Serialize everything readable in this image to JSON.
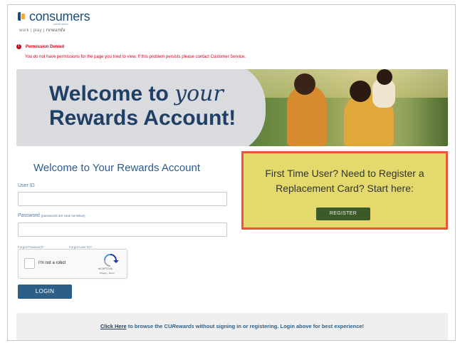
{
  "logo": {
    "wordmark": "consumers",
    "subtext": "credit union",
    "tagline_prefix": "work | play | ",
    "tagline_script": "rewards"
  },
  "error": {
    "icon": "alert-icon",
    "title": "Permission Denied",
    "message": "You do not have permissions for the page you tried to view. If this problem persists please contact Customer Service."
  },
  "banner": {
    "line1_prefix": "Welcome to ",
    "line1_script": "your",
    "line2": "Rewards Account!"
  },
  "login": {
    "heading": "Welcome to Your Rewards Account",
    "user_id_label": "User ID",
    "password_label": "Password",
    "password_note": "(passwords are case sensitive)",
    "forgot_password": "Forgot Password?",
    "forgot_user_id": "Forgot User ID?",
    "login_button": "LOGIN"
  },
  "captcha": {
    "checkbox_label": "I'm not a robot",
    "brand": "reCAPTCHA",
    "terms": "Privacy - Terms"
  },
  "register": {
    "text": "First Time User? Need to Register a Replacement Card? Start here:",
    "button": "REGISTER"
  },
  "footer": {
    "link_text": "Click Here",
    "text_before_italic": " to browse the CU",
    "italic_text": "Rewards",
    "text_after": " without signing in or registering. Login above for best experience!"
  },
  "colors": {
    "brand_blue": "#1f3f66",
    "error_red": "#d0021b",
    "register_panel": "#e3d96c",
    "highlight_border": "#e8553a",
    "register_button": "#3c5a28"
  }
}
